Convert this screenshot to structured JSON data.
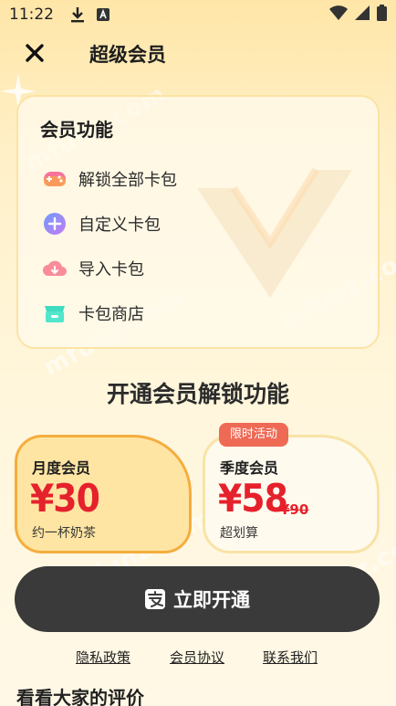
{
  "status_bar": {
    "time": "11:22",
    "icons": [
      "download-icon",
      "app-notification-icon",
      "wifi-icon",
      "signal-icon",
      "battery-icon"
    ]
  },
  "header": {
    "title": "超级会员",
    "close_icon": "close-icon"
  },
  "watermark": "mfunz.com",
  "features": {
    "title": "会员功能",
    "items": [
      {
        "label": "解锁全部卡包",
        "icon": "gamepad-icon",
        "color": "#f8729b"
      },
      {
        "label": "自定义卡包",
        "icon": "plus-circle-icon",
        "color": "#8b8cf7"
      },
      {
        "label": "导入卡包",
        "icon": "cloud-download-icon",
        "color": "#f98aa0"
      },
      {
        "label": "卡包商店",
        "icon": "store-icon",
        "color": "#3fdcc0"
      }
    ]
  },
  "section_title": "开通会员解锁功能",
  "plans": {
    "monthly": {
      "name": "月度会员",
      "price": "¥30",
      "desc": "约一杯奶茶",
      "selected": true
    },
    "season": {
      "name": "季度会员",
      "price": "¥58",
      "old_price": "¥90",
      "desc": "超划算",
      "badge": "限时活动"
    }
  },
  "cta": {
    "label": "立即开通",
    "icon": "alipay-icon"
  },
  "links": {
    "privacy": "隐私政策",
    "agreement": "会员协议",
    "contact": "联系我们"
  },
  "reviews_title": "看看大家的评价",
  "colors": {
    "accent_red": "#e5212c",
    "cta_bg": "#3a3a3a",
    "badge_bg": "#ef6a55",
    "selected_border": "#f5ad3e"
  }
}
